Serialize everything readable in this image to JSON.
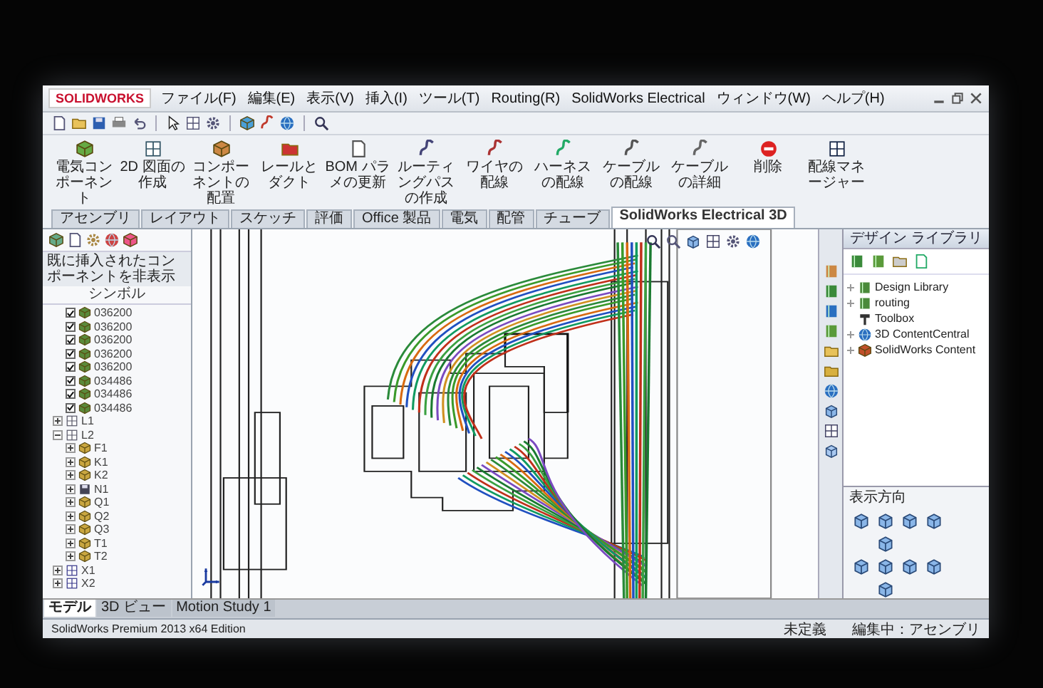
{
  "menubar": {
    "logo": "SOLIDWORKS",
    "items": [
      "ファイル(F)",
      "編集(E)",
      "表示(V)",
      "挿入(I)",
      "ツール(T)",
      "Routing(R)",
      "SolidWorks Electrical",
      "ウィンドウ(W)",
      "ヘルプ(H)"
    ]
  },
  "ribbon": {
    "buttons": [
      {
        "label": "電気コンポーネント"
      },
      {
        "label": "2D 図面の作成"
      },
      {
        "label": "コンポーネントの配置"
      },
      {
        "label": "レールとダクト"
      },
      {
        "label": "BOM パラメの更新"
      },
      {
        "label": "ルーティングパスの作成"
      },
      {
        "label": "ワイヤの配線"
      },
      {
        "label": "ハーネスの配線"
      },
      {
        "label": "ケーブルの配線"
      },
      {
        "label": "ケーブルの詳細"
      },
      {
        "label": "削除"
      },
      {
        "label": "配線マネージャー"
      }
    ],
    "tabs": [
      {
        "label": "アセンブリ",
        "selected": false
      },
      {
        "label": "レイアウト",
        "selected": false
      },
      {
        "label": "スケッチ",
        "selected": false
      },
      {
        "label": "評価",
        "selected": false
      },
      {
        "label": "Office 製品",
        "selected": false
      },
      {
        "label": "電気",
        "selected": false
      },
      {
        "label": "配管",
        "selected": false
      },
      {
        "label": "チューブ",
        "selected": false
      },
      {
        "label": "SolidWorks Electrical 3D",
        "selected": true
      }
    ]
  },
  "left_panel": {
    "header": "既に挿入されたコンポーネントを非表示",
    "column_label": "シンボル",
    "symbols": [
      {
        "label": "036200",
        "checked": true
      },
      {
        "label": "036200",
        "checked": true
      },
      {
        "label": "036200",
        "checked": true
      },
      {
        "label": "036200",
        "checked": true
      },
      {
        "label": "036200",
        "checked": true
      },
      {
        "label": "034486",
        "checked": true
      },
      {
        "label": "034486",
        "checked": true
      },
      {
        "label": "034486",
        "checked": true
      }
    ],
    "tree": [
      {
        "label": "L1",
        "kind": "location",
        "expanded": false
      },
      {
        "label": "L2",
        "kind": "location",
        "expanded": true,
        "children": [
          {
            "label": "F1",
            "kind": "part",
            "expanded": false
          },
          {
            "label": "K1",
            "kind": "part",
            "expanded": false
          },
          {
            "label": "K2",
            "kind": "part",
            "expanded": false
          },
          {
            "label": "N1",
            "kind": "block",
            "expanded": false
          },
          {
            "label": "Q1",
            "kind": "part",
            "expanded": false
          },
          {
            "label": "Q2",
            "kind": "part",
            "expanded": false
          },
          {
            "label": "Q3",
            "kind": "part",
            "expanded": false
          },
          {
            "label": "T1",
            "kind": "part",
            "expanded": false
          },
          {
            "label": "T2",
            "kind": "part",
            "expanded": false
          }
        ]
      },
      {
        "label": "X1",
        "kind": "terminal",
        "expanded": false
      },
      {
        "label": "X2",
        "kind": "terminal",
        "expanded": false
      }
    ],
    "tabs": [
      {
        "label": "モデル",
        "selected": true
      },
      {
        "label": "3D ビュー",
        "selected": false
      },
      {
        "label": "Motion Study 1",
        "selected": false
      }
    ]
  },
  "task_pane": {
    "title": "デザイン ライブラリ",
    "items": [
      {
        "label": "Design Library",
        "kind": "library"
      },
      {
        "label": "routing",
        "kind": "library"
      },
      {
        "label": "Toolbox",
        "kind": "toolbox"
      },
      {
        "label": "3D ContentCentral",
        "kind": "globe"
      },
      {
        "label": "SolidWorks Content",
        "kind": "content"
      }
    ],
    "view_panel": {
      "title": "表示方向"
    }
  },
  "status_bar": {
    "product": "SolidWorks Premium 2013 x64 Edition",
    "fields": [
      "未定義",
      "編集中：アセンブリ"
    ]
  }
}
